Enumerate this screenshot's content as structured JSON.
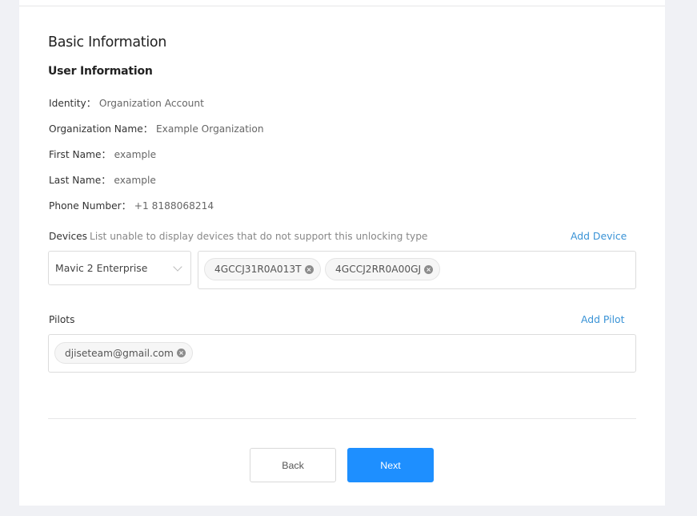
{
  "page": {
    "section_title": "Basic Information",
    "sub_title": "User Information"
  },
  "user_info": [
    {
      "label": "Identity：",
      "value": "Organization Account"
    },
    {
      "label": "Organization Name：",
      "value": "Example Organization"
    },
    {
      "label": "First Name：",
      "value": "example"
    },
    {
      "label": "Last Name：",
      "value": "example"
    },
    {
      "label": "Phone Number：",
      "value": "+1 8188068214"
    }
  ],
  "devices": {
    "label": "Devices",
    "hint": "List unable to display devices that do not support this unlocking type",
    "add_link": "Add Device",
    "model_select": {
      "value": "Mavic 2 Enterprise",
      "icon": "chevron-down-icon"
    },
    "tags": [
      {
        "label": "4GCCJ31R0A013T",
        "close_icon": "×"
      },
      {
        "label": "4GCCJ2RR0A00GJ",
        "close_icon": "×"
      }
    ]
  },
  "pilots": {
    "label": "Pilots",
    "add_link": "Add Pilot",
    "tags": [
      {
        "label": "djiseteam@gmail.com",
        "close_icon": "×"
      }
    ]
  },
  "actions": {
    "back_label": "Back",
    "next_label": "Next"
  },
  "colors": {
    "primary": "#1e8fff",
    "link": "#3a93d6",
    "background": "#f0f1f5"
  }
}
